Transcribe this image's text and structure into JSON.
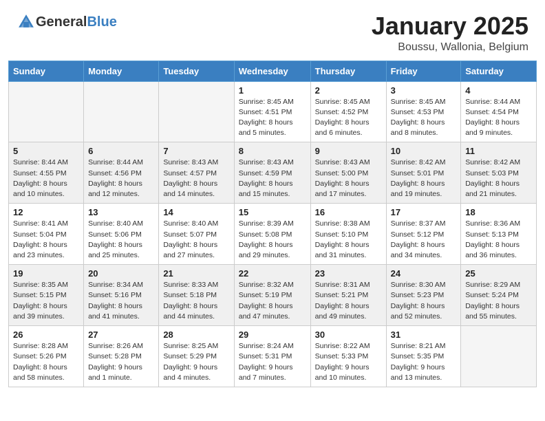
{
  "header": {
    "logo_general": "General",
    "logo_blue": "Blue",
    "month": "January 2025",
    "location": "Boussu, Wallonia, Belgium"
  },
  "weekdays": [
    "Sunday",
    "Monday",
    "Tuesday",
    "Wednesday",
    "Thursday",
    "Friday",
    "Saturday"
  ],
  "weeks": [
    [
      {
        "day": "",
        "info": ""
      },
      {
        "day": "",
        "info": ""
      },
      {
        "day": "",
        "info": ""
      },
      {
        "day": "1",
        "info": "Sunrise: 8:45 AM\nSunset: 4:51 PM\nDaylight: 8 hours\nand 5 minutes."
      },
      {
        "day": "2",
        "info": "Sunrise: 8:45 AM\nSunset: 4:52 PM\nDaylight: 8 hours\nand 6 minutes."
      },
      {
        "day": "3",
        "info": "Sunrise: 8:45 AM\nSunset: 4:53 PM\nDaylight: 8 hours\nand 8 minutes."
      },
      {
        "day": "4",
        "info": "Sunrise: 8:44 AM\nSunset: 4:54 PM\nDaylight: 8 hours\nand 9 minutes."
      }
    ],
    [
      {
        "day": "5",
        "info": "Sunrise: 8:44 AM\nSunset: 4:55 PM\nDaylight: 8 hours\nand 10 minutes."
      },
      {
        "day": "6",
        "info": "Sunrise: 8:44 AM\nSunset: 4:56 PM\nDaylight: 8 hours\nand 12 minutes."
      },
      {
        "day": "7",
        "info": "Sunrise: 8:43 AM\nSunset: 4:57 PM\nDaylight: 8 hours\nand 14 minutes."
      },
      {
        "day": "8",
        "info": "Sunrise: 8:43 AM\nSunset: 4:59 PM\nDaylight: 8 hours\nand 15 minutes."
      },
      {
        "day": "9",
        "info": "Sunrise: 8:43 AM\nSunset: 5:00 PM\nDaylight: 8 hours\nand 17 minutes."
      },
      {
        "day": "10",
        "info": "Sunrise: 8:42 AM\nSunset: 5:01 PM\nDaylight: 8 hours\nand 19 minutes."
      },
      {
        "day": "11",
        "info": "Sunrise: 8:42 AM\nSunset: 5:03 PM\nDaylight: 8 hours\nand 21 minutes."
      }
    ],
    [
      {
        "day": "12",
        "info": "Sunrise: 8:41 AM\nSunset: 5:04 PM\nDaylight: 8 hours\nand 23 minutes."
      },
      {
        "day": "13",
        "info": "Sunrise: 8:40 AM\nSunset: 5:06 PM\nDaylight: 8 hours\nand 25 minutes."
      },
      {
        "day": "14",
        "info": "Sunrise: 8:40 AM\nSunset: 5:07 PM\nDaylight: 8 hours\nand 27 minutes."
      },
      {
        "day": "15",
        "info": "Sunrise: 8:39 AM\nSunset: 5:08 PM\nDaylight: 8 hours\nand 29 minutes."
      },
      {
        "day": "16",
        "info": "Sunrise: 8:38 AM\nSunset: 5:10 PM\nDaylight: 8 hours\nand 31 minutes."
      },
      {
        "day": "17",
        "info": "Sunrise: 8:37 AM\nSunset: 5:12 PM\nDaylight: 8 hours\nand 34 minutes."
      },
      {
        "day": "18",
        "info": "Sunrise: 8:36 AM\nSunset: 5:13 PM\nDaylight: 8 hours\nand 36 minutes."
      }
    ],
    [
      {
        "day": "19",
        "info": "Sunrise: 8:35 AM\nSunset: 5:15 PM\nDaylight: 8 hours\nand 39 minutes."
      },
      {
        "day": "20",
        "info": "Sunrise: 8:34 AM\nSunset: 5:16 PM\nDaylight: 8 hours\nand 41 minutes."
      },
      {
        "day": "21",
        "info": "Sunrise: 8:33 AM\nSunset: 5:18 PM\nDaylight: 8 hours\nand 44 minutes."
      },
      {
        "day": "22",
        "info": "Sunrise: 8:32 AM\nSunset: 5:19 PM\nDaylight: 8 hours\nand 47 minutes."
      },
      {
        "day": "23",
        "info": "Sunrise: 8:31 AM\nSunset: 5:21 PM\nDaylight: 8 hours\nand 49 minutes."
      },
      {
        "day": "24",
        "info": "Sunrise: 8:30 AM\nSunset: 5:23 PM\nDaylight: 8 hours\nand 52 minutes."
      },
      {
        "day": "25",
        "info": "Sunrise: 8:29 AM\nSunset: 5:24 PM\nDaylight: 8 hours\nand 55 minutes."
      }
    ],
    [
      {
        "day": "26",
        "info": "Sunrise: 8:28 AM\nSunset: 5:26 PM\nDaylight: 8 hours\nand 58 minutes."
      },
      {
        "day": "27",
        "info": "Sunrise: 8:26 AM\nSunset: 5:28 PM\nDaylight: 9 hours\nand 1 minute."
      },
      {
        "day": "28",
        "info": "Sunrise: 8:25 AM\nSunset: 5:29 PM\nDaylight: 9 hours\nand 4 minutes."
      },
      {
        "day": "29",
        "info": "Sunrise: 8:24 AM\nSunset: 5:31 PM\nDaylight: 9 hours\nand 7 minutes."
      },
      {
        "day": "30",
        "info": "Sunrise: 8:22 AM\nSunset: 5:33 PM\nDaylight: 9 hours\nand 10 minutes."
      },
      {
        "day": "31",
        "info": "Sunrise: 8:21 AM\nSunset: 5:35 PM\nDaylight: 9 hours\nand 13 minutes."
      },
      {
        "day": "",
        "info": ""
      }
    ]
  ]
}
